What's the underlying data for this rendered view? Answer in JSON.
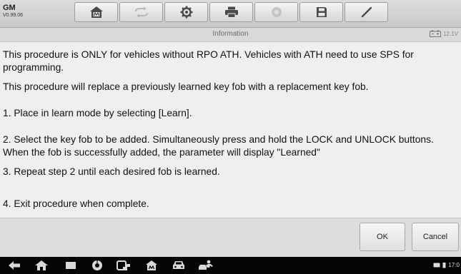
{
  "header": {
    "make": "GM",
    "version": "V0.99.06",
    "toolbar": [
      {
        "icon": "home-icon"
      },
      {
        "icon": "vehicle-swap-icon",
        "disabled": true
      },
      {
        "icon": "settings-gear-icon"
      },
      {
        "icon": "print-icon"
      },
      {
        "icon": "help-icon",
        "disabled": true
      },
      {
        "icon": "save-icon"
      },
      {
        "icon": "pen-icon"
      }
    ]
  },
  "info_bar": {
    "title": "Information",
    "voltage": "12.1V"
  },
  "message": {
    "paragraphs": [
      "This procedure is ONLY for vehicles without RPO ATH. Vehicles with ATH need to use SPS for programming.",
      "This procedure will replace a previously learned key fob with a replacement key fob.",
      " 1. Place in learn mode by selecting [Learn].",
      " 2. Select the key fob to be added. Simultaneously press and hold the LOCK and UNLOCK buttons. When the fob is successfully added, the parameter will display \"Learned\"",
      " 3. Repeat step 2 until each desired fob is learned.",
      " 4. Exit procedure when complete."
    ]
  },
  "buttons": {
    "ok": "OK",
    "cancel": "Cancel"
  },
  "android_nav": {
    "time": "17:0"
  },
  "colors": {
    "toolbar_bg": "#d0d0d0",
    "content_bg": "#efefef",
    "nav_bg": "#050505"
  }
}
